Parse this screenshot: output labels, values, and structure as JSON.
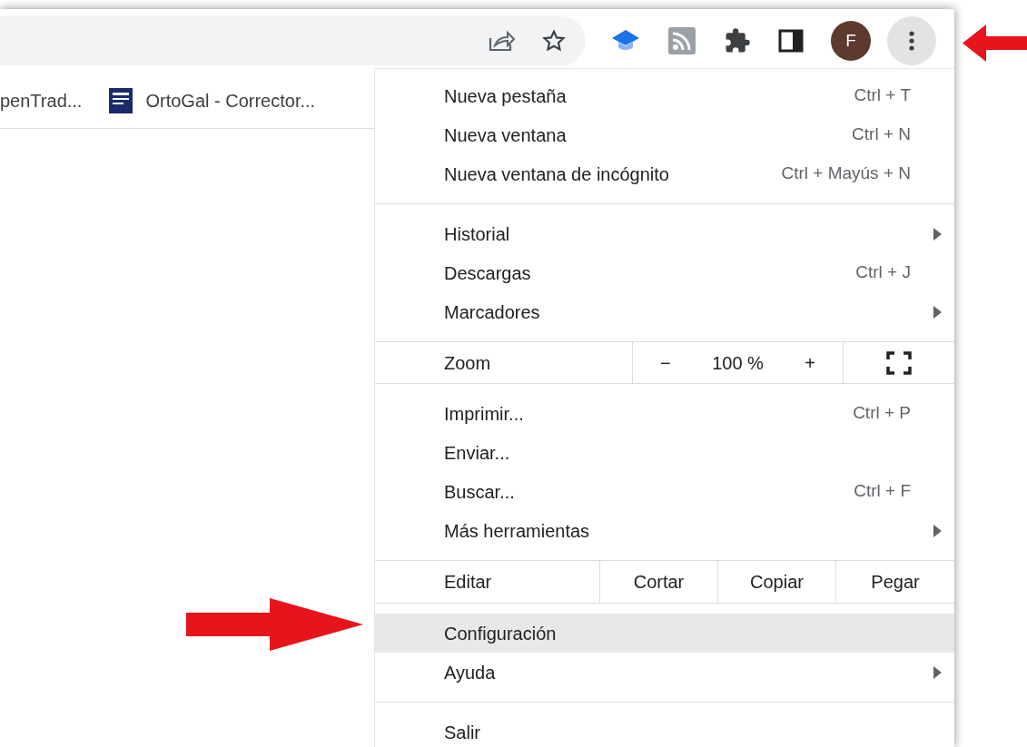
{
  "toolbar": {
    "profile_initial": "F"
  },
  "bookmarks": [
    {
      "label": "penTrad...",
      "favicon": false
    },
    {
      "label": "OrtoGal - Corrector...",
      "favicon": true
    }
  ],
  "menu": {
    "sections": [
      {
        "items": [
          {
            "kind": "item",
            "label": "Nueva pestaña",
            "shortcut": "Ctrl + T",
            "submenu": false,
            "selected": false
          },
          {
            "kind": "item",
            "label": "Nueva ventana",
            "shortcut": "Ctrl + N",
            "submenu": false,
            "selected": false
          },
          {
            "kind": "item",
            "label": "Nueva ventana de incógnito",
            "shortcut": "Ctrl + Mayús + N",
            "submenu": false,
            "selected": false
          }
        ]
      },
      {
        "items": [
          {
            "kind": "item",
            "label": "Historial",
            "submenu": true,
            "selected": false
          },
          {
            "kind": "item",
            "label": "Descargas",
            "shortcut": "Ctrl + J",
            "submenu": false,
            "selected": false
          },
          {
            "kind": "item",
            "label": "Marcadores",
            "submenu": true,
            "selected": false
          }
        ]
      },
      {
        "items": [
          {
            "kind": "zoom",
            "label": "Zoom",
            "minus": "−",
            "value": "100 %",
            "plus": "+"
          }
        ]
      },
      {
        "items": [
          {
            "kind": "item",
            "label": "Imprimir...",
            "shortcut": "Ctrl + P",
            "submenu": false,
            "selected": false
          },
          {
            "kind": "item",
            "label": "Enviar...",
            "submenu": false,
            "selected": false
          },
          {
            "kind": "item",
            "label": "Buscar...",
            "shortcut": "Ctrl + F",
            "submenu": false,
            "selected": false
          },
          {
            "kind": "item",
            "label": "Más herramientas",
            "submenu": true,
            "selected": false
          }
        ]
      },
      {
        "items": [
          {
            "kind": "edit",
            "label": "Editar",
            "actions": [
              "Cortar",
              "Copiar",
              "Pegar"
            ]
          }
        ]
      },
      {
        "items": [
          {
            "kind": "item",
            "label": "Configuración",
            "submenu": false,
            "selected": true
          },
          {
            "kind": "item",
            "label": "Ayuda",
            "submenu": true,
            "selected": false
          }
        ]
      },
      {
        "items": [
          {
            "kind": "item",
            "label": "Salir",
            "submenu": false,
            "selected": false
          }
        ]
      }
    ]
  }
}
